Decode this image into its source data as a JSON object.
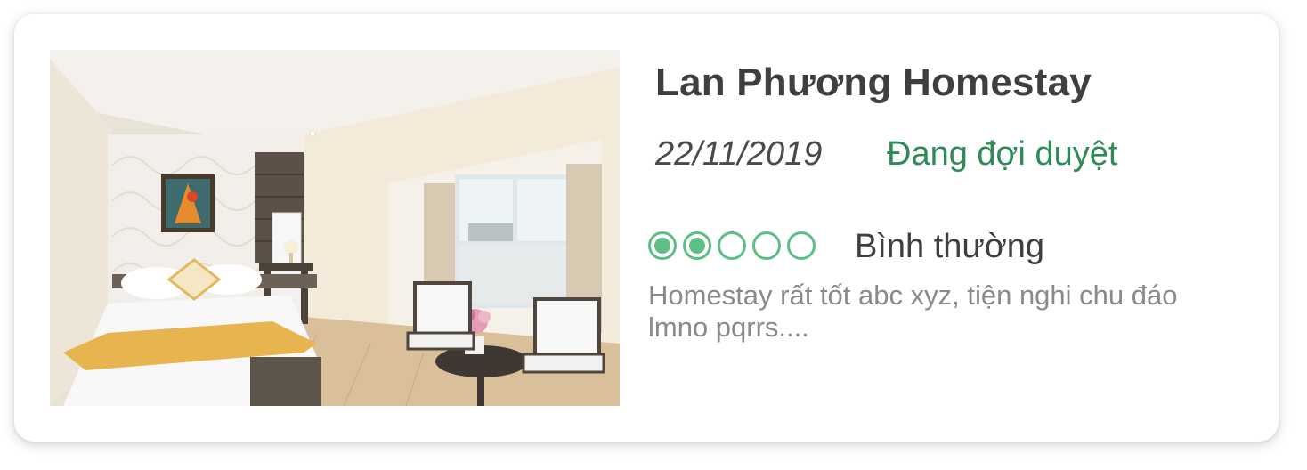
{
  "listing": {
    "title": "Lan Phương Homestay",
    "date": "22/11/2019",
    "status": "Đang đợi duyệt",
    "status_color": "#2e8b57",
    "rating": {
      "value": 2,
      "max": 5,
      "label": "Bình thường",
      "bubble_color": "#5dbf85"
    },
    "review_text": "Homestay rất tốt abc xyz, tiện nghi chu đáo lmno pqrrs....",
    "photo": {
      "icon": "hotel-room-photo"
    }
  }
}
